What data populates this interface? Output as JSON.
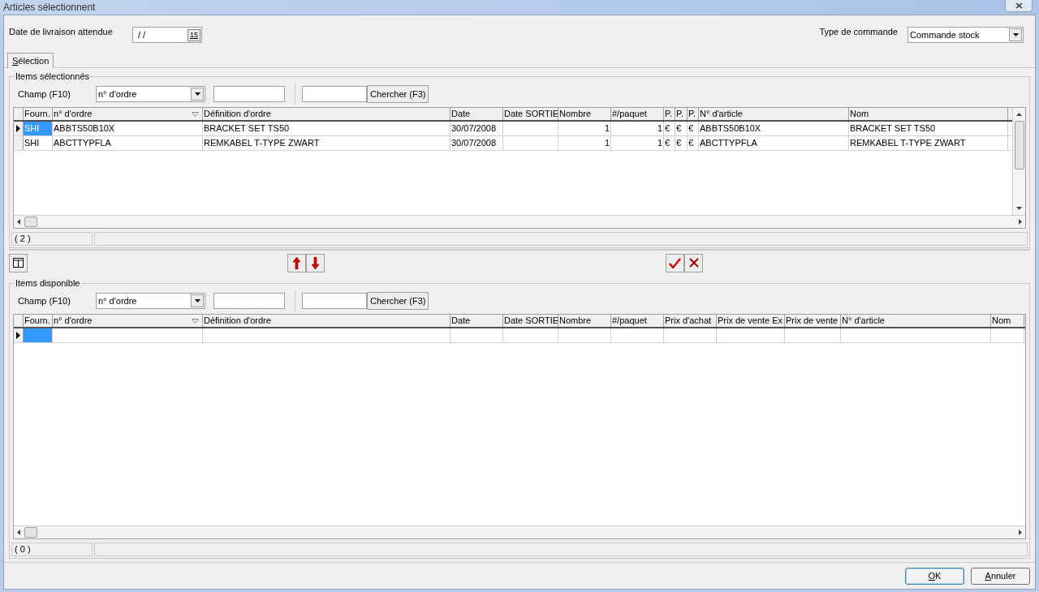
{
  "window": {
    "title": "Articles sélectionnent"
  },
  "delivery_date": {
    "label": "Date de livraison attendue",
    "value": "/ /",
    "calendar_glyph": "15"
  },
  "order_type": {
    "label": "Type de commande",
    "value": "Commande stock"
  },
  "tabs": [
    {
      "label": "Sélection",
      "selected": true
    }
  ],
  "sections": [
    {
      "title": "Items sélectionnés",
      "field_label": "Champ (F10)",
      "field_value": "n° d'ordre",
      "search_button": "Chercher (F3)",
      "columns": [
        {
          "label": "Fourn.",
          "kind": "text"
        },
        {
          "label": "n° d'ordre",
          "kind": "text",
          "sort_indicator": true
        },
        {
          "label": "Définition d'ordre",
          "kind": "text"
        },
        {
          "label": "Date",
          "kind": "text"
        },
        {
          "label": "Date SORTIE",
          "kind": "text"
        },
        {
          "label": "Nombre",
          "kind": "number"
        },
        {
          "label": "#/paquet",
          "kind": "number"
        },
        {
          "label": "P.",
          "kind": "text"
        },
        {
          "label": "P.",
          "kind": "text"
        },
        {
          "label": "P.",
          "kind": "text"
        },
        {
          "label": "N° d'article",
          "kind": "text"
        },
        {
          "label": "Nom",
          "kind": "text"
        }
      ],
      "rows": [
        {
          "current": true,
          "cells": [
            "SHI",
            "ABBTS50B10X",
            "BRACKET SET TS50",
            "30/07/2008",
            "",
            "1",
            "1",
            "€",
            "€",
            "€",
            "ABBTS50B10X",
            "BRACKET SET TS50"
          ]
        },
        {
          "current": false,
          "cells": [
            "SHI",
            "ABCTTYPFLA",
            "REMKABEL T-TYPE ZWART",
            "30/07/2008",
            "",
            "1",
            "1",
            "€",
            "€",
            "€",
            "ABCTTYPFLA",
            "REMKABEL T-TYPE ZWART"
          ]
        }
      ],
      "vertical_scrollbar": true,
      "status": "( 2 )"
    },
    {
      "title": "Items disponible",
      "field_label": "Champ (F10)",
      "field_value": "n° d'ordre",
      "search_button": "Chercher (F3)",
      "columns": [
        {
          "label": "Fourn.",
          "kind": "text"
        },
        {
          "label": "n° d'ordre",
          "kind": "text",
          "sort_indicator": true
        },
        {
          "label": "Définition d'ordre",
          "kind": "text"
        },
        {
          "label": "Date",
          "kind": "text"
        },
        {
          "label": "Date SORTIE",
          "kind": "text"
        },
        {
          "label": "Nombre",
          "kind": "number"
        },
        {
          "label": "#/paquet",
          "kind": "number"
        },
        {
          "label": "Prix d'achat",
          "kind": "text"
        },
        {
          "label": "Prix de vente Ex",
          "kind": "text"
        },
        {
          "label": "Prix de vente",
          "kind": "text"
        },
        {
          "label": "N° d'article",
          "kind": "text"
        },
        {
          "label": "Nom",
          "kind": "text"
        }
      ],
      "rows": [
        {
          "current": true
        }
      ],
      "vertical_scrollbar": false,
      "status": "( 0 )"
    }
  ],
  "buttons": [
    {
      "label": "OK",
      "default": true
    },
    {
      "label": "Annuler",
      "default": false
    }
  ]
}
